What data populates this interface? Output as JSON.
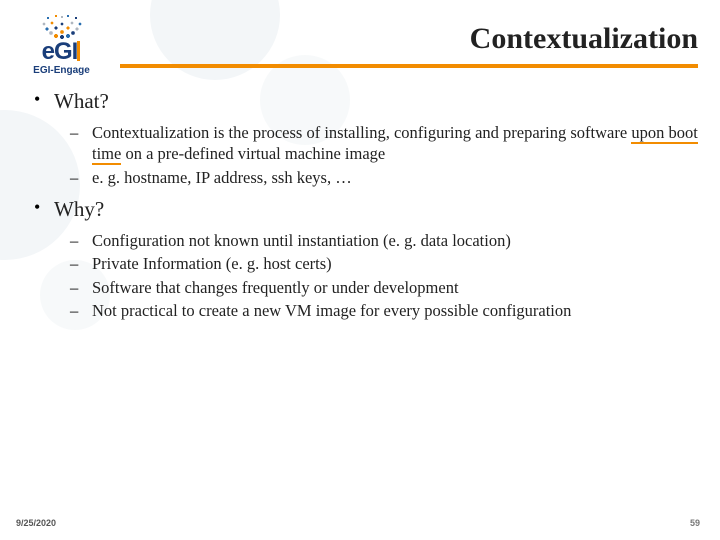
{
  "logo": {
    "text": "eGI",
    "subtext": "EGI-Engage"
  },
  "title": "Contextualization",
  "bullets": [
    {
      "label": "What?",
      "subs": [
        {
          "parts": [
            {
              "t": "Contextualization is the process of installing, configuring and preparing software "
            },
            {
              "t": "upon boot time",
              "u": true
            },
            {
              "t": " on a pre-defined virtual machine image"
            }
          ]
        },
        {
          "parts": [
            {
              "t": "e. g. hostname, IP address, ssh keys, …"
            }
          ]
        }
      ]
    },
    {
      "label": "Why?",
      "subs": [
        {
          "parts": [
            {
              "t": "Configuration not known until instantiation (e. g. data location)"
            }
          ]
        },
        {
          "parts": [
            {
              "t": "Private Information (e. g. host certs)"
            }
          ]
        },
        {
          "parts": [
            {
              "t": "Software that changes frequently or under development"
            }
          ]
        },
        {
          "parts": [
            {
              "t": "Not practical to create a new VM image for every possible configuration"
            }
          ]
        }
      ]
    }
  ],
  "footer": {
    "date": "9/25/2020",
    "page": "59"
  }
}
